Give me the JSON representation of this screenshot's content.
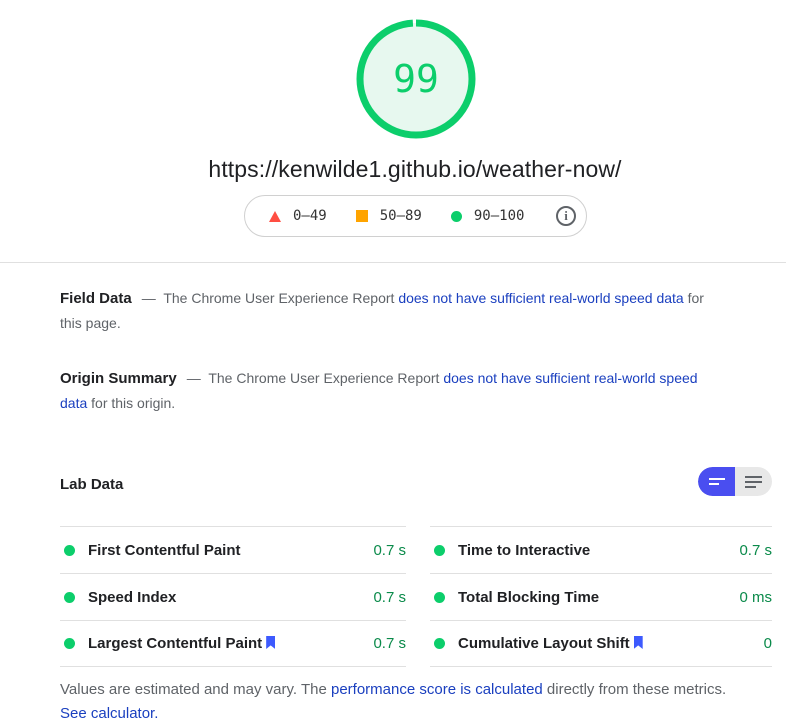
{
  "score": {
    "value": "99",
    "fraction": 0.99,
    "color": "#0cce6b"
  },
  "url": "https://kenwilde1.github.io/weather-now/",
  "legend": {
    "fail": "0–49",
    "average": "50–89",
    "pass": "90–100",
    "info_icon": "info-icon"
  },
  "field_data": {
    "heading": "Field Data",
    "dash": "—",
    "prefix": "The Chrome User Experience Report",
    "link": "does not have sufficient real-world speed data",
    "suffix": "for this page."
  },
  "origin_summary": {
    "heading": "Origin Summary",
    "dash": "—",
    "prefix": "The Chrome User Experience Report",
    "link": "does not have sufficient real-world speed data",
    "suffix": "for this origin."
  },
  "lab_data": {
    "title": "Lab Data",
    "toggle_icons": [
      "summary-view-icon",
      "list-view-icon"
    ],
    "metrics_left": [
      {
        "label": "First Contentful Paint",
        "value": "0.7 s"
      },
      {
        "label": "Speed Index",
        "value": "0.7 s"
      },
      {
        "label": "Largest Contentful Paint",
        "value": "0.7 s"
      }
    ],
    "metrics_right": [
      {
        "label": "Time to Interactive",
        "value": "0.7 s"
      },
      {
        "label": "Total Blocking Time",
        "value": "0 ms"
      },
      {
        "label": "Cumulative Layout Shift",
        "value": "0"
      }
    ]
  },
  "footer": {
    "text1": "Values are estimated and may vary. The",
    "link1": "performance score is calculated",
    "text2": "directly from these metrics.",
    "link2": "See calculator."
  },
  "colors": {
    "pass": "#0cce6b",
    "average": "#ffa400",
    "fail": "#ff4e42",
    "link": "#1a3fbf",
    "toggle_active": "#4a4ef0"
  }
}
